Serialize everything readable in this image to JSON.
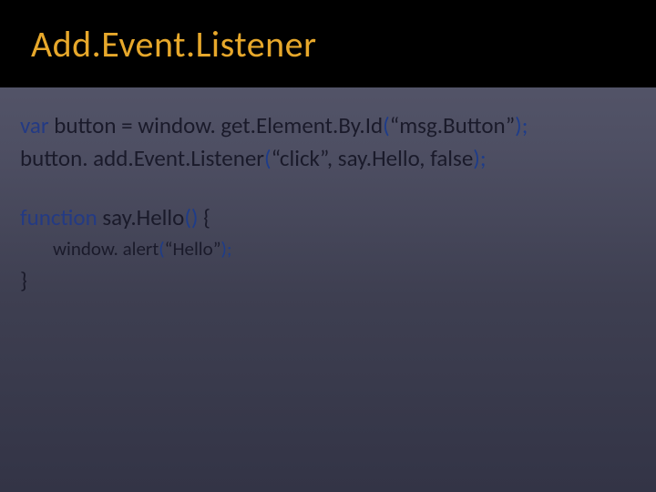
{
  "header": {
    "title": "Add.Event.Listener"
  },
  "code": {
    "line1": {
      "kw": "var",
      "rest_a": " button = window. get.Element.By.Id",
      "paren_open": "(",
      "str": "“msg.Button”",
      "paren_close": ");"
    },
    "line2": {
      "rest_a": "button. add.Event.Listener",
      "paren_open": "(",
      "args": "“click”, say.Hello, false",
      "paren_close": ");"
    },
    "line3": {
      "kw": "function",
      "name": " say.Hello",
      "paren_open": "(",
      "paren_close": ")",
      "brace": " {"
    },
    "line4": {
      "rest_a": "window. alert",
      "paren_open": "(",
      "str": "“Hello”",
      "paren_close": ");"
    },
    "line5": {
      "brace": "}"
    }
  }
}
